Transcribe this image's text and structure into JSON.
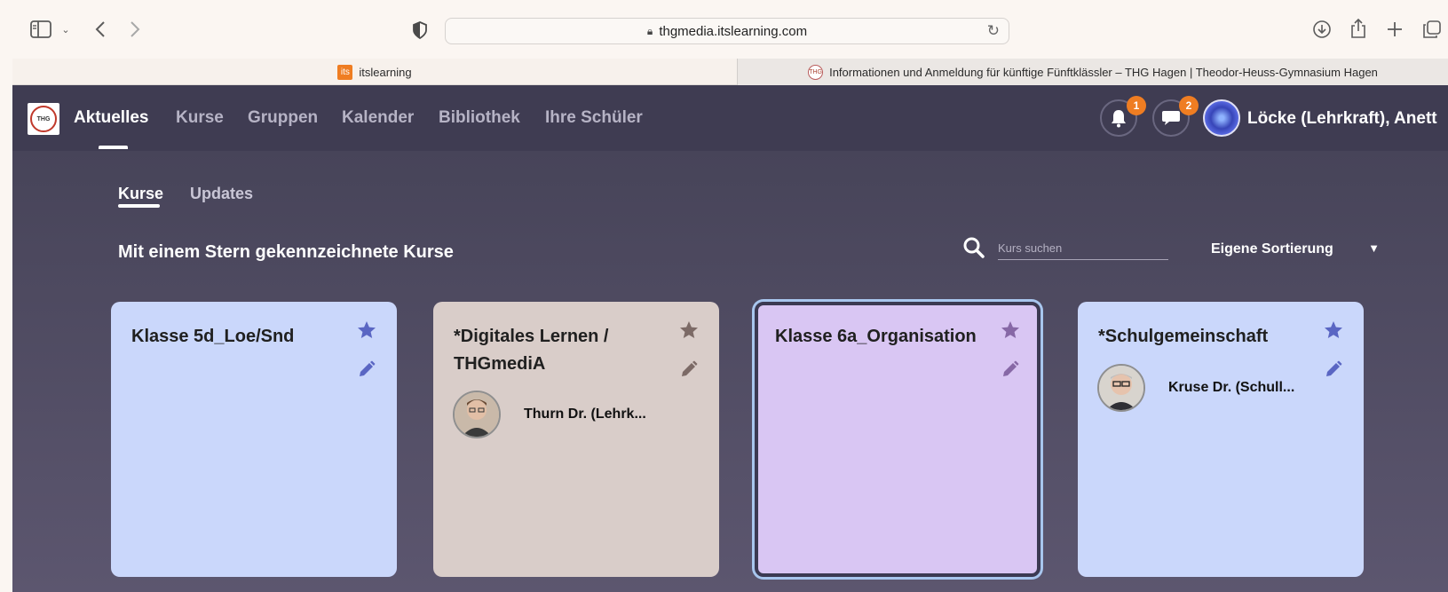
{
  "browser": {
    "url": "thgmedia.itslearning.com",
    "tabs": [
      {
        "label": "itslearning",
        "favicon": "its",
        "active": true
      },
      {
        "label": "Informationen und Anmeldung für künftige Fünftklässler – THG Hagen | Theodor-Heuss-Gymnasium Hagen",
        "favicon": "thg-logo",
        "active": false
      }
    ]
  },
  "nav": {
    "items": [
      {
        "label": "Aktuelles",
        "active": true
      },
      {
        "label": "Kurse",
        "active": false
      },
      {
        "label": "Gruppen",
        "active": false
      },
      {
        "label": "Kalender",
        "active": false
      },
      {
        "label": "Bibliothek",
        "active": false
      },
      {
        "label": "Ihre Schüler",
        "active": false
      }
    ],
    "notifications_count": "1",
    "messages_count": "2",
    "user_name": "Löcke (Lehrkraft), Anett"
  },
  "subtabs": [
    {
      "label": "Kurse",
      "active": true
    },
    {
      "label": "Updates",
      "active": false
    }
  ],
  "section": {
    "title": "Mit einem Stern gekennzeichnete Kurse",
    "search_placeholder": "Kurs suchen",
    "sort_label": "Eigene Sortierung"
  },
  "courses": [
    {
      "title": "Klasse 5d_Loe/Snd",
      "owner": "",
      "color": "#cad7fb",
      "icon_color": "#5a66c3"
    },
    {
      "title": "*Digitales Lernen / THGmediA",
      "owner": "Thurn Dr. (Lehrk...",
      "color": "#d9cdc9",
      "icon_color": "#7c6a66"
    },
    {
      "title": "Klasse 6a_Organisation",
      "owner": "",
      "color": "#d9c6f3",
      "icon_color": "#8768a6"
    },
    {
      "title": "*Schulgemeinschaft",
      "owner": "Kruse Dr. (Schull...",
      "color": "#cad7fb",
      "icon_color": "#5a66c3"
    }
  ],
  "colors": {
    "header_bg": "#3f3c52",
    "accent_orange": "#ef7d22"
  }
}
